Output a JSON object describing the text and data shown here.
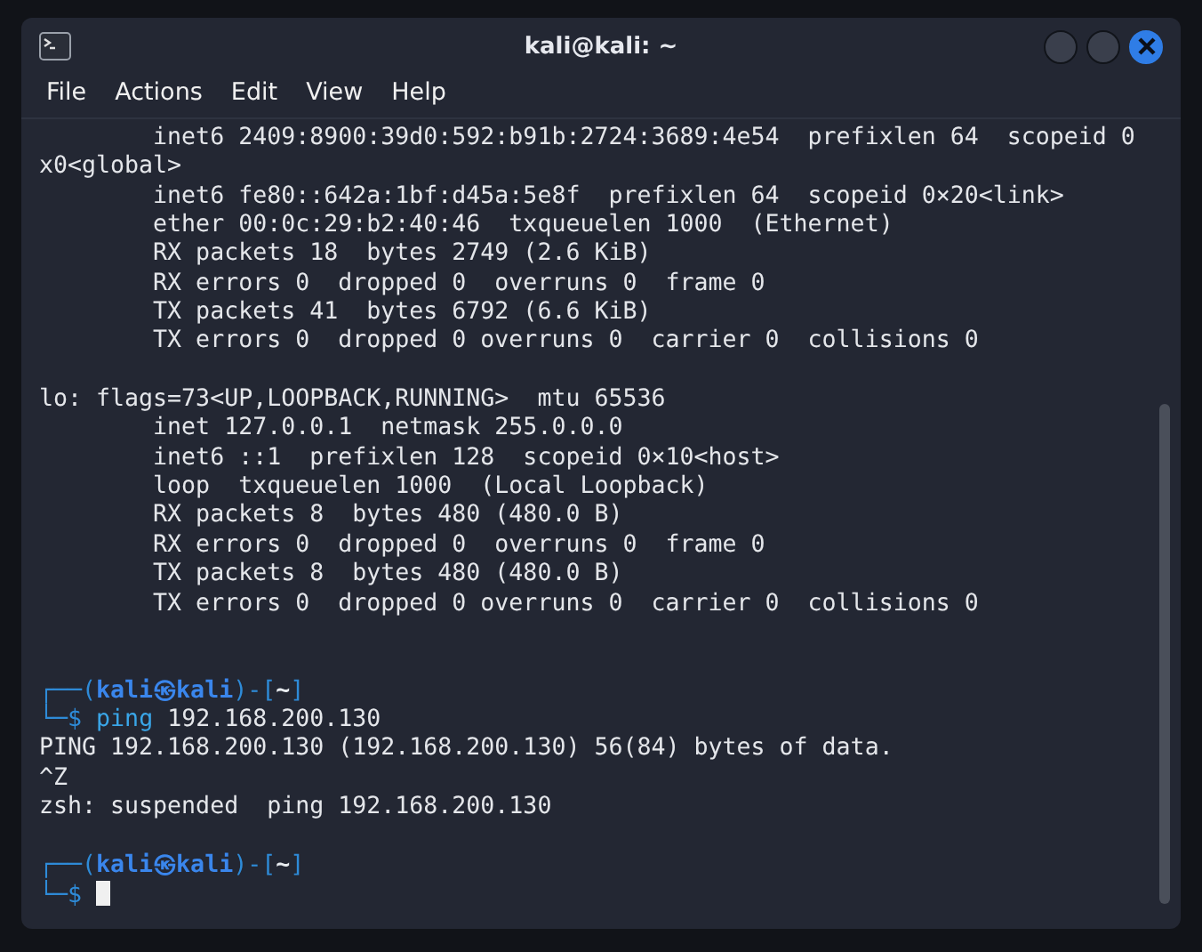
{
  "window": {
    "title": "kali@kali: ~"
  },
  "menu": [
    "File",
    "Actions",
    "Edit",
    "View",
    "Help"
  ],
  "terminal": {
    "lines": [
      {
        "kind": "output",
        "text": "        inet6 2409:8900:39d0:592:b91b:2724:3689:4e54  prefixlen 64  scopeid 0"
      },
      {
        "kind": "output",
        "text": "x0<global>"
      },
      {
        "kind": "output",
        "text": "        inet6 fe80::642a:1bf:d45a:5e8f  prefixlen 64  scopeid 0×20<link>"
      },
      {
        "kind": "output",
        "text": "        ether 00:0c:29:b2:40:46  txqueuelen 1000  (Ethernet)"
      },
      {
        "kind": "output",
        "text": "        RX packets 18  bytes 2749 (2.6 KiB)"
      },
      {
        "kind": "output",
        "text": "        RX errors 0  dropped 0  overruns 0  frame 0"
      },
      {
        "kind": "output",
        "text": "        TX packets 41  bytes 6792 (6.6 KiB)"
      },
      {
        "kind": "output",
        "text": "        TX errors 0  dropped 0 overruns 0  carrier 0  collisions 0"
      },
      {
        "kind": "blank"
      },
      {
        "kind": "output",
        "text": "lo: flags=73<UP,LOOPBACK,RUNNING>  mtu 65536"
      },
      {
        "kind": "output",
        "text": "        inet 127.0.0.1  netmask 255.0.0.0"
      },
      {
        "kind": "output",
        "text": "        inet6 ::1  prefixlen 128  scopeid 0×10<host>"
      },
      {
        "kind": "output",
        "text": "        loop  txqueuelen 1000  (Local Loopback)"
      },
      {
        "kind": "output",
        "text": "        RX packets 8  bytes 480 (480.0 B)"
      },
      {
        "kind": "output",
        "text": "        RX errors 0  dropped 0  overruns 0  frame 0"
      },
      {
        "kind": "output",
        "text": "        TX packets 8  bytes 480 (480.0 B)"
      },
      {
        "kind": "output",
        "text": "        TX errors 0  dropped 0 overruns 0  carrier 0  collisions 0"
      },
      {
        "kind": "blank"
      },
      {
        "kind": "blank"
      },
      {
        "kind": "prompt_head",
        "open": "┌──(",
        "user": "kali㉿kali",
        "mid": ")-[",
        "cwd": "~",
        "close": "]"
      },
      {
        "kind": "command",
        "sign": "└─$",
        "command": "ping",
        "args": "192.168.200.130"
      },
      {
        "kind": "output",
        "text": "PING 192.168.200.130 (192.168.200.130) 56(84) bytes of data."
      },
      {
        "kind": "output",
        "text": "^Z"
      },
      {
        "kind": "output",
        "text": "zsh: suspended  ping 192.168.200.130"
      },
      {
        "kind": "blank"
      },
      {
        "kind": "prompt_head",
        "open": "┌──(",
        "user": "kali㉿kali",
        "mid": ")-[",
        "cwd": "~",
        "close": "]"
      },
      {
        "kind": "input",
        "sign": "└─$"
      }
    ]
  }
}
